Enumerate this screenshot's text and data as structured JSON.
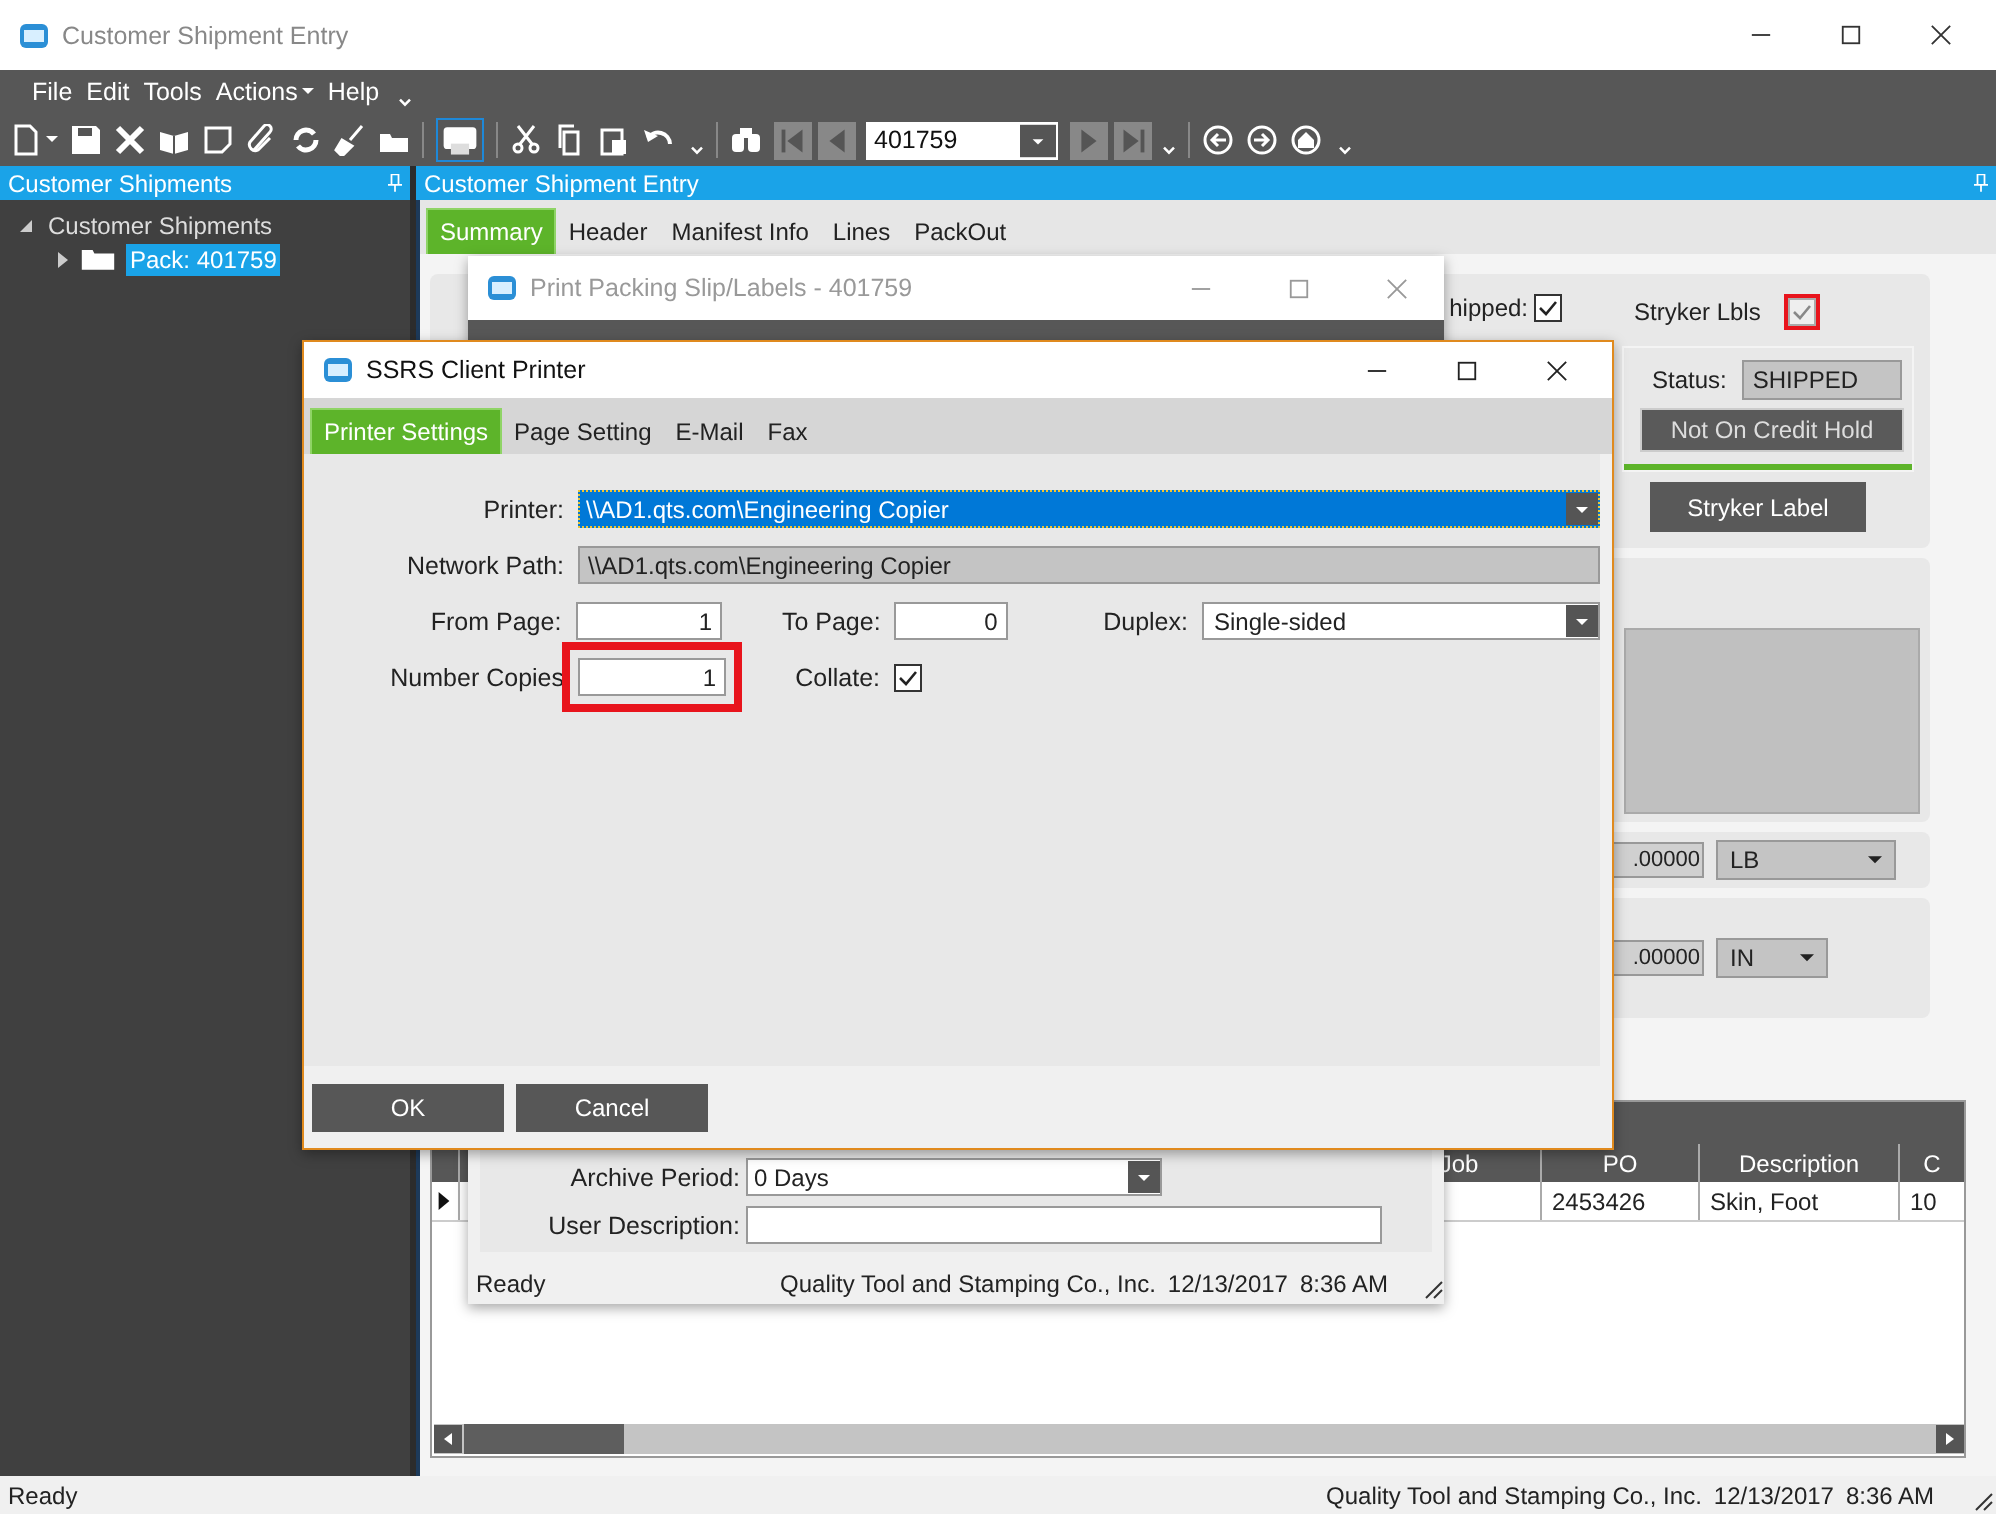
{
  "window": {
    "title": "Customer Shipment Entry"
  },
  "menu": [
    {
      "label": "File",
      "kind": "plain"
    },
    {
      "label": "Edit",
      "kind": "plain"
    },
    {
      "label": "Tools",
      "kind": "plain"
    },
    {
      "label": "Actions",
      "kind": "dropdown"
    },
    {
      "label": "Help",
      "kind": "plain"
    }
  ],
  "toolbar": {
    "record": "401759"
  },
  "tree_panel": {
    "title": "Customer Shipments",
    "items": [
      {
        "label": "Customer Shipments",
        "expanded": true,
        "selected": false,
        "children": [
          {
            "label": "Pack: 401759",
            "expanded": false,
            "selected": true
          }
        ]
      }
    ]
  },
  "content": {
    "title": "Customer Shipment Entry",
    "tabs": [
      {
        "label": "Summary",
        "selected": true
      },
      {
        "label": "Header",
        "selected": false
      },
      {
        "label": "Manifest Info",
        "selected": false
      },
      {
        "label": "Lines",
        "selected": false
      },
      {
        "label": "PackOut",
        "selected": false
      }
    ],
    "summary": {
      "shipped_label": "hipped:",
      "shipped": true,
      "stryker_lbls_label": "Stryker Lbls",
      "stryker_lbls": true,
      "stryker_lbls_disabled": true,
      "status_label": "Status:",
      "status": "SHIPPED",
      "credit_button": "Not On Credit Hold",
      "stryker_button": "Stryker Label",
      "weight": ".00000",
      "weight_unit": "LB",
      "dimension": ".00000",
      "dimension_unit": "IN"
    },
    "grid": {
      "columns": [
        "Job",
        "PO",
        "Description",
        "C"
      ],
      "rows": [
        {
          "po": "2453426",
          "description": "Skin, Foot",
          "column_4": "10"
        }
      ]
    }
  },
  "status_bar": {
    "text": "Ready",
    "company": "Quality Tool and Stamping Co., Inc.",
    "date": "12/13/2017",
    "time": "8:36 AM"
  },
  "print_dialog": {
    "title": "Print Packing Slip/Labels - 401759",
    "archive_label": "Archive Period:",
    "archive_period": "0 Days",
    "user_description_label": "User Description:",
    "status_bar": {
      "text": "Ready",
      "company": "Quality Tool and Stamping Co., Inc.",
      "date": "12/13/2017",
      "time": "8:36 AM"
    }
  },
  "printer_dialog": {
    "title": "SSRS Client Printer",
    "tabs": [
      {
        "label": "Printer Settings",
        "selected": true
      },
      {
        "label": "Page Setting",
        "selected": false
      },
      {
        "label": "E-Mail",
        "selected": false
      },
      {
        "label": "Fax",
        "selected": false
      }
    ],
    "printer_label": "Printer:",
    "printer": "\\\\AD1.qts.com\\Engineering Copier",
    "network_path_label": "Network Path:",
    "network_path": "\\\\AD1.qts.com\\Engineering Copier",
    "from_page_label": "From Page:",
    "from_page": "1",
    "to_page_label": "To Page:",
    "to_page": "0",
    "duplex_label": "Duplex:",
    "duplex": "Single-sided",
    "copies_label": "Number Copies",
    "copies": "1",
    "collate_label": "Collate:",
    "collate": true,
    "buttons": [
      "OK",
      "Cancel"
    ]
  }
}
